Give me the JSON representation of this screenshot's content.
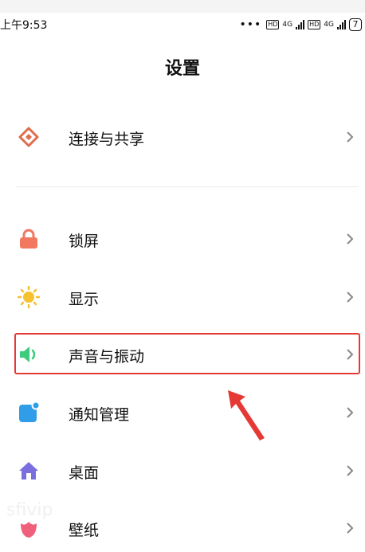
{
  "status_bar": {
    "time": "上午9:53",
    "dots": "•••",
    "hd_label": "HD",
    "network_label": "4G",
    "battery": "7"
  },
  "page": {
    "title": "设置"
  },
  "items": [
    {
      "label": "连接与共享",
      "icon": "share-icon",
      "color": "#e06c4b"
    },
    {
      "label": "锁屏",
      "icon": "lock-icon",
      "color": "#f2785f"
    },
    {
      "label": "显示",
      "icon": "sun-icon",
      "color": "#f5c12e"
    },
    {
      "label": "声音与振动",
      "icon": "speaker-icon",
      "color": "#3ccc7c"
    },
    {
      "label": "通知管理",
      "icon": "notification-icon",
      "color": "#2f9de8"
    },
    {
      "label": "桌面",
      "icon": "home-icon",
      "color": "#7b6fe0"
    },
    {
      "label": "壁纸",
      "icon": "flower-icon",
      "color": "#f0607c"
    }
  ],
  "annotation": {
    "highlight_color": "#e53935"
  },
  "watermark": "sfivip"
}
